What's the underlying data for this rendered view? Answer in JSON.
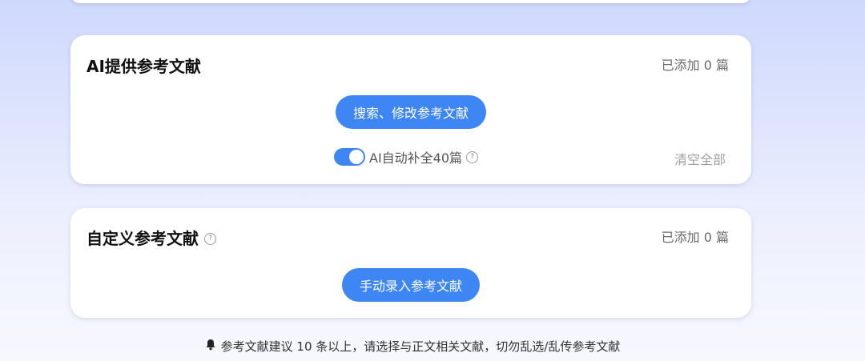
{
  "ai_section": {
    "title": "AI提供参考文献",
    "count_label": "已添加 0 篇",
    "search_button": "搜索、修改参考文献",
    "auto_fill_label": "AI自动补全40篇",
    "auto_fill_enabled": true,
    "clear_all": "清空全部"
  },
  "custom_section": {
    "title": "自定义参考文献",
    "count_label": "已添加 0 篇",
    "manual_button": "手动录入参考文献"
  },
  "notice": {
    "text": "参考文献建议 10 条以上，请选择与正文相关文献，切勿乱选/乱传参考文献"
  },
  "icons": {
    "help": "question-circle-icon",
    "bell": "bell-icon"
  },
  "colors": {
    "accent": "#3d86f3",
    "muted": "#a0a0a0"
  }
}
